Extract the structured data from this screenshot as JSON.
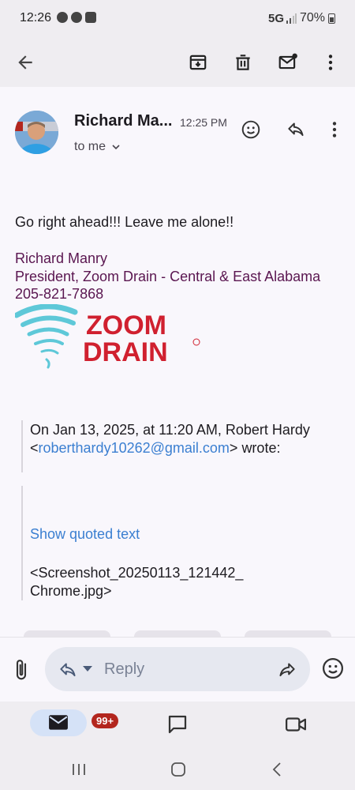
{
  "status_bar": {
    "time": "12:26",
    "network": "5G",
    "battery": "70%"
  },
  "toolbar": {
    "back": "back-arrow-icon",
    "archive": "archive-icon",
    "delete": "trash-icon",
    "mark_unread": "mark-unread-icon",
    "more": "more-vert-icon"
  },
  "message": {
    "sender": "Richard Ma...",
    "time": "12:25 PM",
    "recipients": "to me",
    "body": "Go right ahead!!! Leave me alone!!",
    "signature": {
      "name": "Richard Manry",
      "title": "President, Zoom Drain - Central & East Alabama",
      "phone": "205-821-7868"
    },
    "logo_text": [
      "ZOOM",
      "DRAIN"
    ],
    "quote": {
      "intro": "On Jan 13, 2025, at 11:20 AM, Robert Hardy",
      "email": "roberthardy10262@gmail.com",
      "wrote": "wrote:",
      "show_quoted": "Show quoted text",
      "attachment_line1": "<Screenshot_20250113_121442_",
      "attachment_line2": "Chrome.jpg>"
    }
  },
  "reply_bar": {
    "placeholder": "Reply"
  },
  "bottom_nav": {
    "mail_badge": "99+"
  },
  "colors": {
    "accent": "#3b7fd1",
    "signature": "#5a1650",
    "badge": "#b3261e",
    "logo_red": "#d0202f",
    "logo_teal": "#5ec8d8"
  }
}
